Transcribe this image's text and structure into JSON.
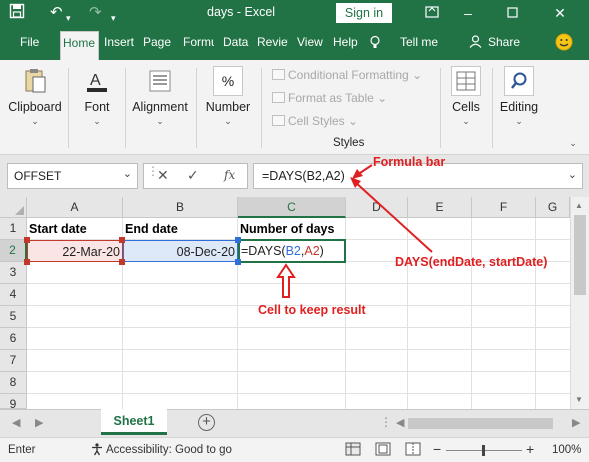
{
  "titlebar": {
    "title": "days  -  Excel",
    "signin_label": "Sign in",
    "save_icon": "save-icon",
    "undo_icon": "undo-icon",
    "redo_icon": "redo-icon",
    "qat_icon": "customize-qat-icon"
  },
  "tabs": [
    {
      "label": "File"
    },
    {
      "label": "Home"
    },
    {
      "label": "Insert"
    },
    {
      "label": "Page Layout"
    },
    {
      "label": "Formulas"
    },
    {
      "label": "Data"
    },
    {
      "label": "Review"
    },
    {
      "label": "View"
    },
    {
      "label": "Help"
    },
    {
      "label": "Tell me"
    },
    {
      "label": "Share"
    }
  ],
  "ribbon": {
    "clipboard": "Clipboard",
    "font": "Font",
    "alignment": "Alignment",
    "number": "Number",
    "cond_format": "Conditional Formatting",
    "format_table": "Format as Table",
    "cell_styles": "Cell Styles",
    "styles_caption": "Styles",
    "cells": "Cells",
    "editing": "Editing",
    "chev": "⌄",
    "chev_inline": "⌄"
  },
  "formula_bar": {
    "name_box": "OFFSET",
    "cancel": "✕",
    "enter": "✓",
    "fx": "fx",
    "formula": "=DAYS(B2,A2)"
  },
  "sheet": {
    "columns": [
      "A",
      "B",
      "C",
      "D",
      "E",
      "F",
      "G"
    ],
    "rows": [
      "1",
      "2",
      "3",
      "4",
      "5",
      "6",
      "7",
      "8",
      "9"
    ],
    "a1": "Start date",
    "b1": "End date",
    "c1": "Number of days",
    "a2": "22-Mar-20",
    "b2": "08-Dec-20",
    "c2_prefix": "=DAYS(",
    "c2_ref1": "B2",
    "c2_comma": ",",
    "c2_ref2": "A2",
    "c2_suffix": ")"
  },
  "sheet_tabs": {
    "active": "Sheet1",
    "add": "+",
    "more": "⋮"
  },
  "status_bar": {
    "mode": "Enter",
    "accessibility": "Accessibility: Good to go",
    "zoom_minus": "−",
    "zoom_plus": "+",
    "zoom": "100%"
  },
  "annotations": {
    "formula_bar": "Formula bar",
    "days_syntax": "DAYS(endDate, startDate)",
    "result_cell": "Cell to keep result"
  },
  "colors": {
    "excel_green": "#217346",
    "annotation_red": "#e02020",
    "ref_blue": "#2f6fd6",
    "ref_red": "#c0392b"
  }
}
